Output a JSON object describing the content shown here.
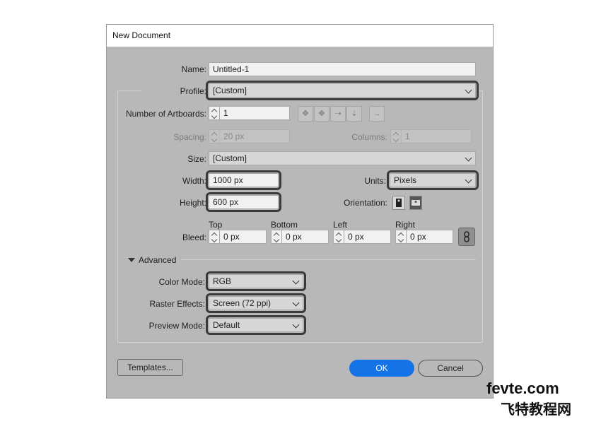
{
  "window": {
    "title": "New Document"
  },
  "fields": {
    "name": {
      "label": "Name:",
      "value": "Untitled-1"
    },
    "profile": {
      "label": "Profile:",
      "value": "[Custom]"
    },
    "artboards": {
      "label": "Number of Artboards:",
      "value": "1"
    },
    "spacing": {
      "label": "Spacing:",
      "value": "20 px"
    },
    "columns": {
      "label": "Columns:",
      "value": "1"
    },
    "size": {
      "label": "Size:",
      "value": "[Custom]"
    },
    "width": {
      "label": "Width:",
      "value": "1000 px"
    },
    "height": {
      "label": "Height:",
      "value": "600 px"
    },
    "units": {
      "label": "Units:",
      "value": "Pixels"
    },
    "orientation": {
      "label": "Orientation:"
    }
  },
  "bleed": {
    "label": "Bleed:",
    "top": {
      "label": "Top",
      "value": "0 px"
    },
    "bottom": {
      "label": "Bottom",
      "value": "0 px"
    },
    "left": {
      "label": "Left",
      "value": "0 px"
    },
    "right": {
      "label": "Right",
      "value": "0 px"
    }
  },
  "advanced": {
    "label": "Advanced",
    "color_mode": {
      "label": "Color Mode:",
      "value": "RGB"
    },
    "raster_effects": {
      "label": "Raster Effects:",
      "value": "Screen (72 ppi)"
    },
    "preview_mode": {
      "label": "Preview Mode:",
      "value": "Default"
    }
  },
  "buttons": {
    "templates": "Templates...",
    "ok": "OK",
    "cancel": "Cancel"
  },
  "watermark": {
    "line1": "fevte.com",
    "line2": "飞特教程网"
  },
  "colors": {
    "accent": "#1473e6",
    "dialog_bg": "#b8b8b8",
    "highlight": "#3a3a3a"
  }
}
